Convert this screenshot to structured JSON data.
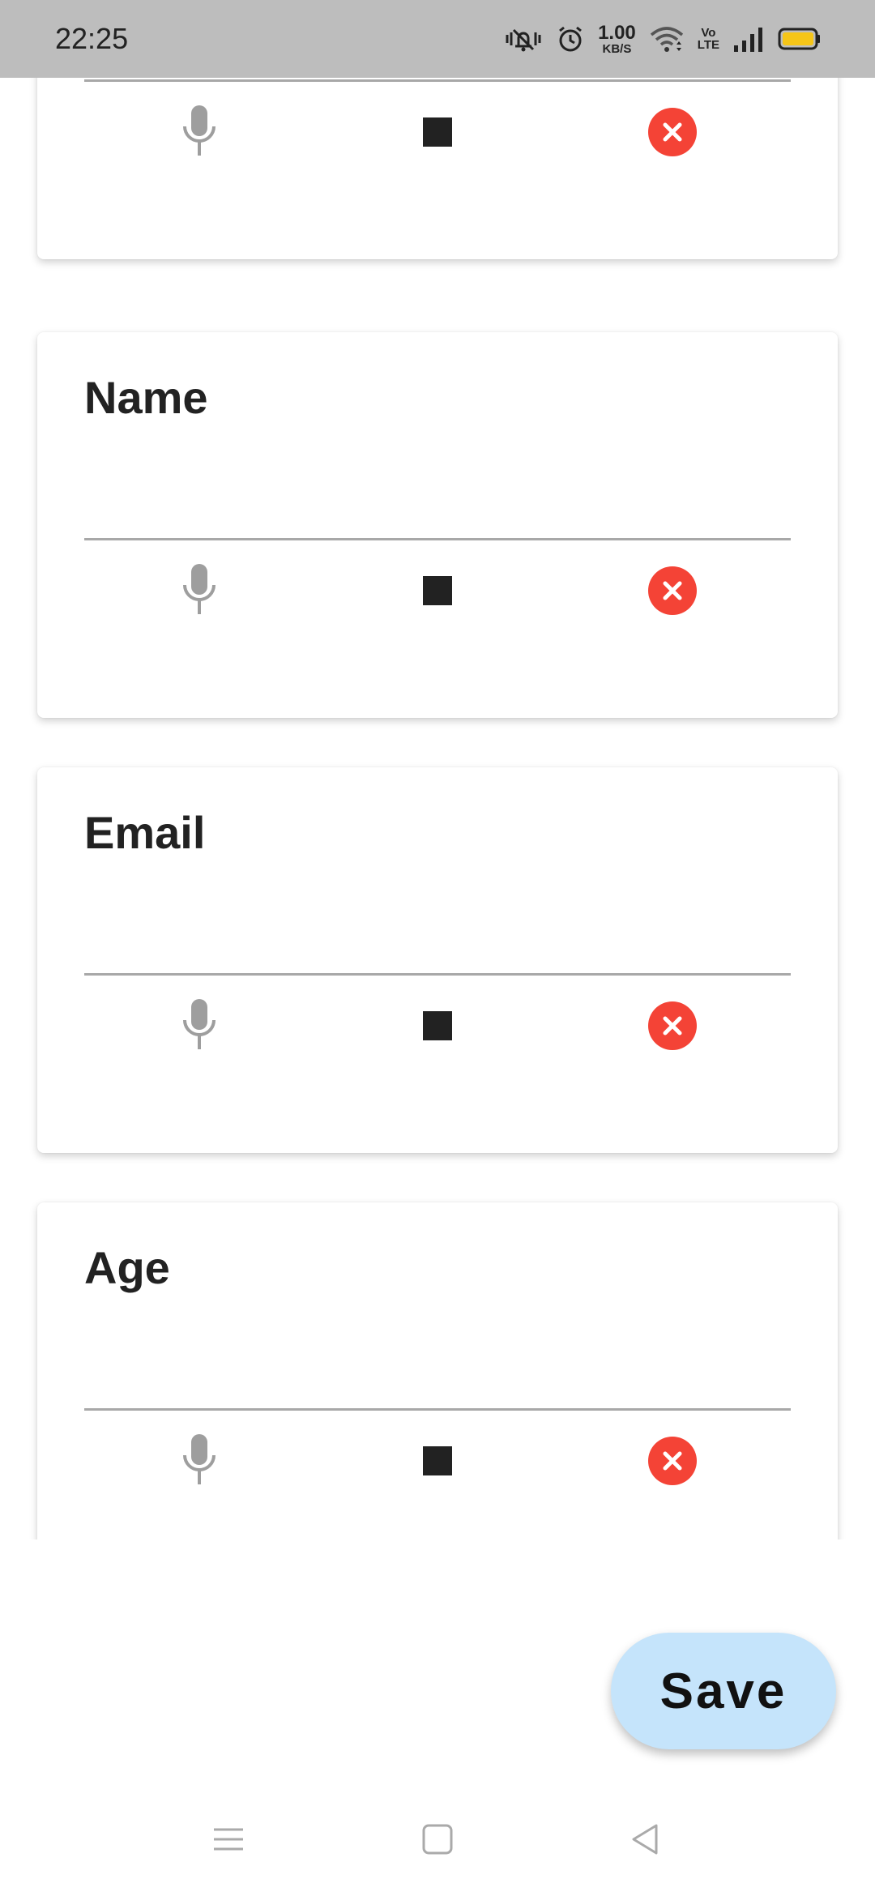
{
  "status_bar": {
    "time": "22:25",
    "net_speed_value": "1.00",
    "net_speed_unit": "KB/S",
    "volte_top": "Vo",
    "volte_bottom": "LTE",
    "icons": [
      "mute-vibrate-icon",
      "alarm-icon",
      "wifi-icon",
      "volte-icon",
      "signal-icon",
      "battery-icon"
    ]
  },
  "fields": [
    {
      "title": "",
      "value": ""
    },
    {
      "title": "Name",
      "value": ""
    },
    {
      "title": "Email",
      "value": ""
    },
    {
      "title": "Age",
      "value": ""
    }
  ],
  "actions": {
    "mic_icon": "mic-icon",
    "stop_icon": "stop-icon",
    "clear_icon": "clear-icon"
  },
  "save_label": "Save",
  "colors": {
    "accent_clear": "#f44336",
    "fab_background": "#c5e4fb",
    "mic_gray": "#9e9e9e",
    "stop_dark": "#222222",
    "status_bar": "#bdbdbd",
    "battery_fill": "#f5c518"
  },
  "nav_bar": {
    "icons": [
      "menu-icon",
      "home-square-icon",
      "back-triangle-icon"
    ]
  }
}
